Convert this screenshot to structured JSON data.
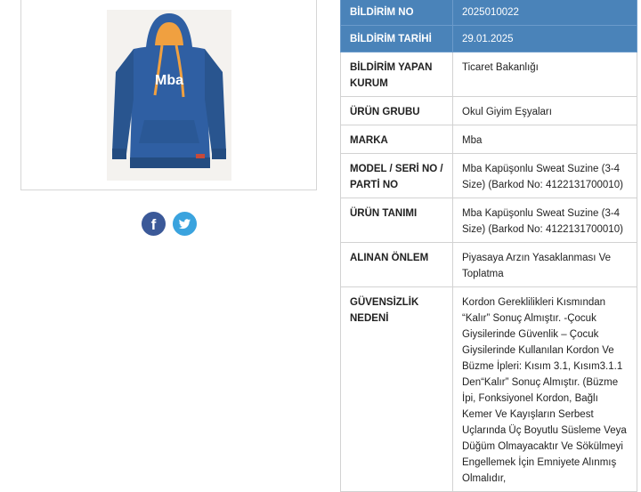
{
  "rows": [
    {
      "label": "BİLDİRİM NO",
      "value": "2025010022"
    },
    {
      "label": "BİLDİRİM TARİHİ",
      "value": "29.01.2025"
    },
    {
      "label": "BİLDİRİM YAPAN KURUM",
      "value": "Ticaret Bakanlığı"
    },
    {
      "label": "ÜRÜN GRUBU",
      "value": "Okul Giyim Eşyaları"
    },
    {
      "label": "MARKA",
      "value": "Mba"
    },
    {
      "label": "MODEL / SERİ NO / PARTİ NO",
      "value": "Mba Kapüşonlu Sweat Suzine (3-4 Size) (Barkod No: 4122131700010)"
    },
    {
      "label": "ÜRÜN TANIMI",
      "value": "Mba Kapüşonlu Sweat Suzine (3-4 Size) (Barkod No: 4122131700010)"
    },
    {
      "label": "ALINAN ÖNLEM",
      "value": "Piyasaya Arzın Yasaklanması Ve Toplatma"
    },
    {
      "label": "GÜVENSİZLİK NEDENİ",
      "value": "Kordon Gereklilikleri Kısmından “Kalır” Sonuç Almıştır. -Çocuk Giysilerinde Güvenlik – Çocuk Giysilerinde Kullanılan Kordon Ve Büzme İpleri: Kısım 3.1, Kısım3.1.1 Den“Kalır” Sonuç Almıştır. (Büzme İpi, Fonksiyonel Kordon, Bağlı Kemer Ve Kayışların Serbest Uçlarında Üç Boyutlu Süsleme Veya Düğüm Olmayacaktır Ve Sökülmeyi Engellemek İçin Emniyete Alınmış Olmalıdır,"
    }
  ],
  "product_image": {
    "print_text": "Mba",
    "icon": "hoodie-photo"
  },
  "share": {
    "facebook_glyph": "f",
    "twitter_icon": "bird-icon"
  },
  "colors": {
    "header_row": "#4a83b9",
    "hoodie": "#2f5fa3",
    "lining": "#f0a040",
    "facebook": "#3b5998",
    "twitter": "#3aa3de"
  }
}
